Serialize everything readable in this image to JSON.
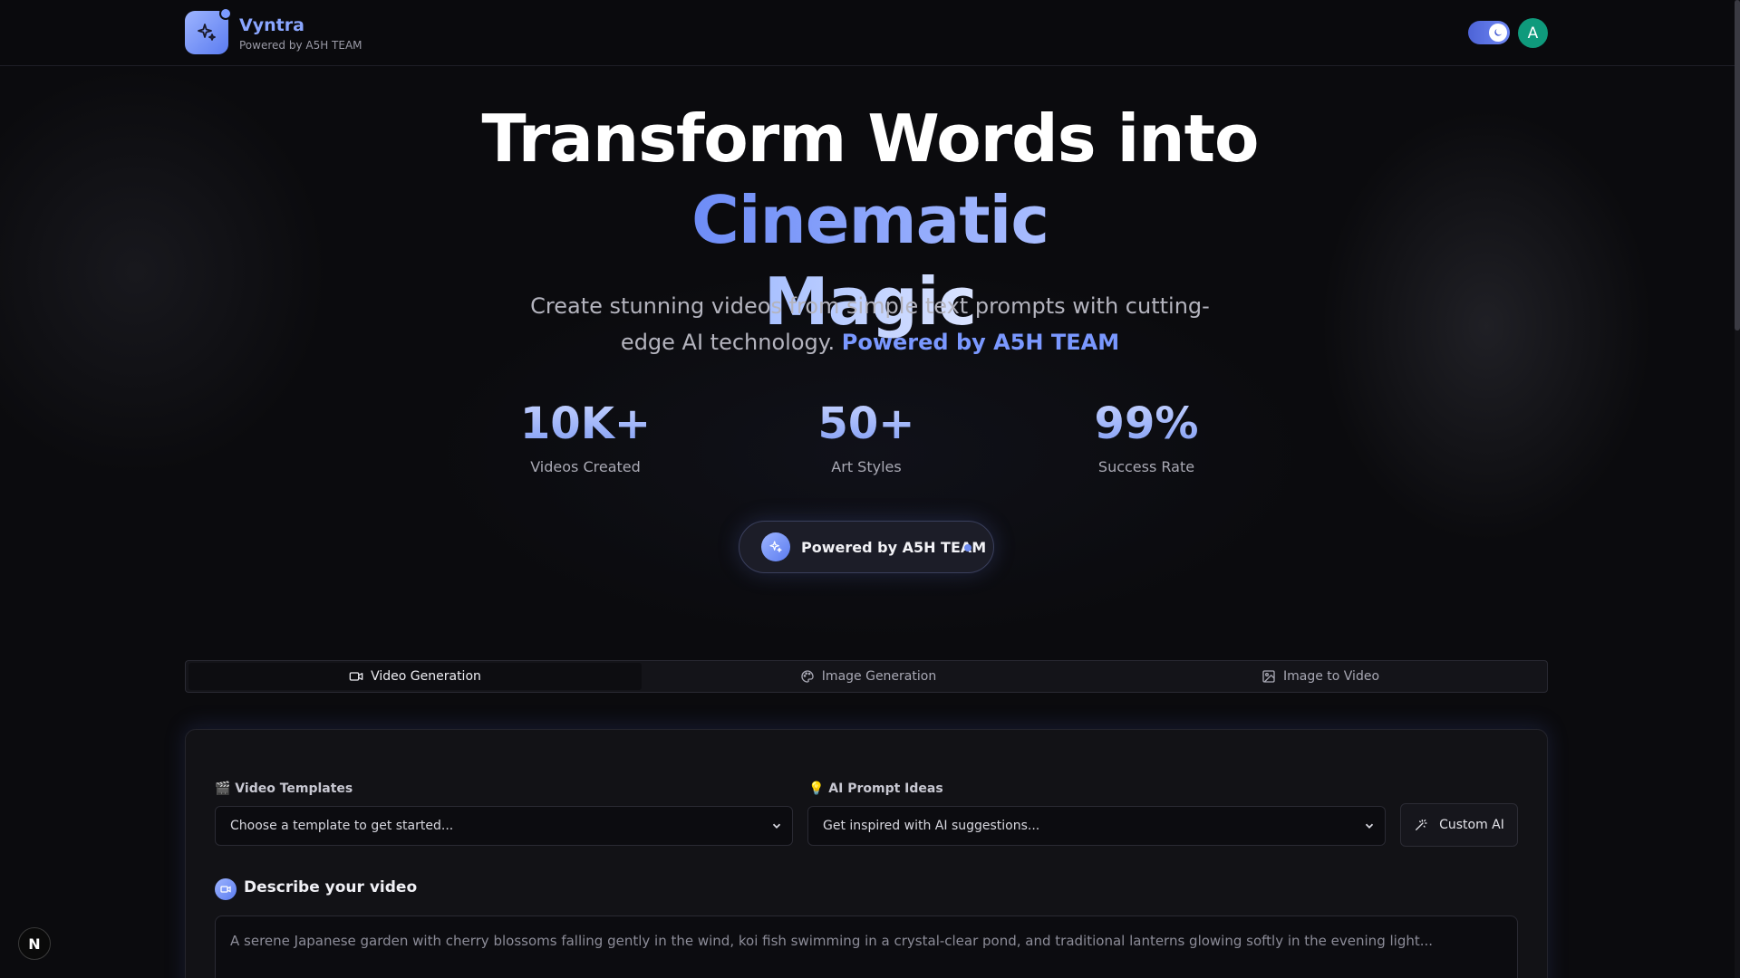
{
  "header": {
    "brand_name": "Vyntra",
    "brand_sub": "Powered by A5H TEAM",
    "avatar_initial": "A",
    "theme": "dark"
  },
  "hero": {
    "title_part1": "Transform Words into ",
    "title_accent": "Cinematic",
    "title_part2": "Magic",
    "subtitle": "Create stunning videos from simple text prompts with cutting-edge AI technology. ",
    "subtitle_accent": "Powered by A5H TEAM"
  },
  "stats": [
    {
      "value": "10K+",
      "label": "Videos Created"
    },
    {
      "value": "50+",
      "label": "Art Styles"
    },
    {
      "value": "99%",
      "label": "Success Rate"
    }
  ],
  "pill": {
    "label": "Powered by A5H TEAM"
  },
  "tabs": [
    {
      "label": "Video Generation",
      "icon": "video-icon",
      "active": true
    },
    {
      "label": "Image Generation",
      "icon": "palette-icon",
      "active": false
    },
    {
      "label": "Image to Video",
      "icon": "image-icon",
      "active": false
    }
  ],
  "form": {
    "templates_label": "🎬 Video Templates",
    "templates_value": "Choose a template to get started...",
    "prompt_ideas_label": "💡 AI Prompt Ideas",
    "prompt_ideas_value": "Get inspired with AI suggestions...",
    "custom_ai_label": "Custom AI",
    "describe_title": "Describe your video",
    "description_placeholder": "A serene Japanese garden with cherry blossoms falling gently in the wind, koi fish swimming in a crystal-clear pond, and traditional lanterns glowing softly in the evening light..."
  },
  "floating_badge": "N",
  "colors": {
    "accent": "#7a98ff",
    "background": "#0b0b0e",
    "avatar": "#0f9a7c"
  }
}
